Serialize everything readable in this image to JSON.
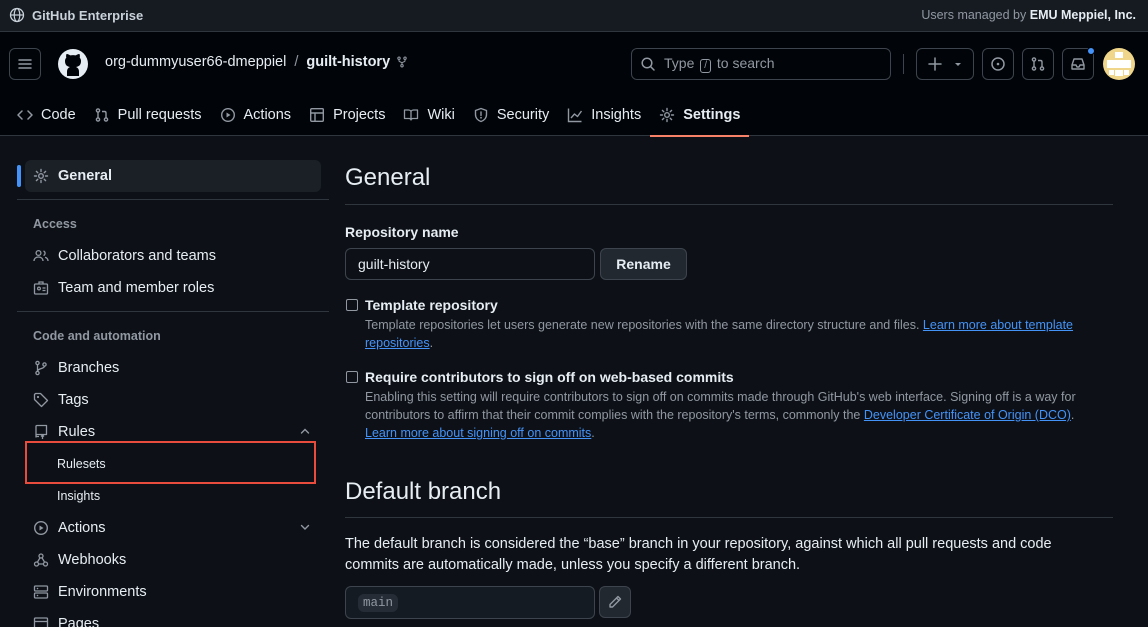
{
  "enterprise_bar": {
    "title": "GitHub Enterprise",
    "managed_prefix": "Users managed by",
    "managed_org": "EMU Meppiel, Inc."
  },
  "header": {
    "owner": "org-dummyuser66-dmeppiel",
    "separator": "/",
    "repo": "guilt-history",
    "search": {
      "prefix": "Type",
      "key": "/",
      "suffix": "to search"
    }
  },
  "tabs": [
    {
      "label": "Code",
      "icon": "code-icon"
    },
    {
      "label": "Pull requests",
      "icon": "git-pull-request-icon"
    },
    {
      "label": "Actions",
      "icon": "play-icon"
    },
    {
      "label": "Projects",
      "icon": "table-icon"
    },
    {
      "label": "Wiki",
      "icon": "book-icon"
    },
    {
      "label": "Security",
      "icon": "shield-icon"
    },
    {
      "label": "Insights",
      "icon": "graph-icon"
    },
    {
      "label": "Settings",
      "icon": "gear-icon",
      "active": true
    }
  ],
  "sidebar": {
    "general": "General",
    "access_heading": "Access",
    "collaborators": "Collaborators and teams",
    "member_roles": "Team and member roles",
    "code_heading": "Code and automation",
    "branches": "Branches",
    "tags": "Tags",
    "rules": "Rules",
    "rulesets": "Rulesets",
    "insights": "Insights",
    "actions": "Actions",
    "webhooks": "Webhooks",
    "environments": "Environments",
    "pages": "Pages"
  },
  "main": {
    "title": "General",
    "repo_name_label": "Repository name",
    "repo_name_value": "guilt-history",
    "rename_button": "Rename",
    "template": {
      "title": "Template repository",
      "desc": "Template repositories let users generate new repositories with the same directory structure and files.",
      "link1": "Learn more about template",
      "link2": "repositories",
      "end": "."
    },
    "signoff": {
      "title": "Require contributors to sign off on web-based commits",
      "desc1": "Enabling this setting will require contributors to sign off on commits made through GitHub's web interface. Signing off is a way for contributors to affirm that their commit complies with the repository's terms, commonly the",
      "link_dco": "Developer Certificate of Origin (DCO)",
      "mid": ".",
      "link_learn": "Learn more about signing off on commits",
      "end": "."
    },
    "default_branch": {
      "title": "Default branch",
      "desc": "The default branch is considered the “base” branch in your repository, against which all pull requests and code commits are automatically made, unless you specify a different branch.",
      "branch": "main"
    }
  },
  "colors": {
    "accent": "#4493f8",
    "tab_underline": "#f78166",
    "highlight_box": "#e74c3c",
    "bg": "#0d1117"
  }
}
